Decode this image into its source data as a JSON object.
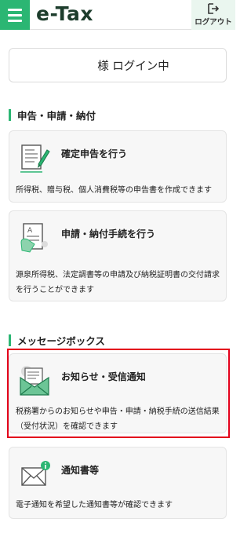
{
  "header": {
    "logo": "e-Tax",
    "logout_label": "ログアウト",
    "menu_icon": "hamburger-icon",
    "logout_icon": "logout-icon"
  },
  "login": {
    "status": "様 ログイン中"
  },
  "sections": {
    "filing": {
      "title": "申告・申請・納付",
      "cards": {
        "tax_return": {
          "title": "確定申告を行う",
          "desc_lines": [
            "所得税、贈与税、個人消費税等の申告書を作成できます"
          ]
        },
        "application": {
          "title": "申請・納付手続を行う",
          "desc_lines": [
            "源泉所得税、法定調書等の申請及び納税証明書の交付請求",
            "を行うことができます"
          ]
        }
      }
    },
    "messages": {
      "title": "メッセージボックス",
      "cards": {
        "notices": {
          "title": "お知らせ・受信通知",
          "desc_lines": [
            "税務署からのお知らせや申告・申請・納税手続の送信結果",
            "（受付状況）を確認できます"
          ]
        },
        "documents": {
          "title": "通知書等",
          "desc_lines": [
            "電子通知を希望した通知書等が確認できます"
          ]
        }
      }
    }
  },
  "colors": {
    "accent": "#2bb673",
    "highlight": "#e3001b",
    "card_bg": "#f7f7f7"
  }
}
